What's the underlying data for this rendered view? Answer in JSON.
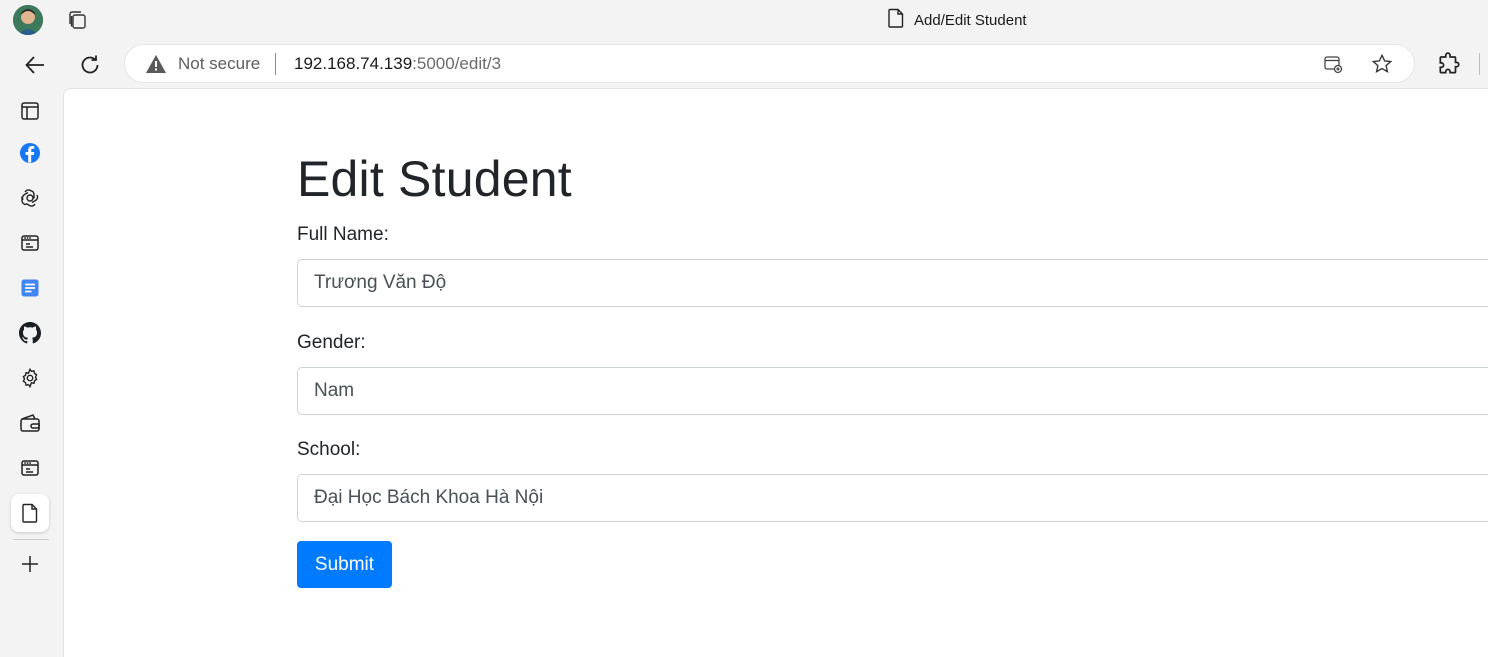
{
  "window": {
    "tab_title": "Add/Edit Student"
  },
  "toolbar": {
    "security_label": "Not secure",
    "url_host": "192.168.74.139",
    "url_path": ":5000/edit/3"
  },
  "sidebar": {
    "items": [
      {
        "name": "sidebar-icon"
      },
      {
        "name": "facebook-icon"
      },
      {
        "name": "openai-icon"
      },
      {
        "name": "app-window-icon"
      },
      {
        "name": "google-docs-icon"
      },
      {
        "name": "github-icon"
      },
      {
        "name": "settings-icon"
      },
      {
        "name": "wallet-icon"
      },
      {
        "name": "app-window-icon"
      },
      {
        "name": "page-icon"
      }
    ]
  },
  "form": {
    "heading": "Edit Student",
    "full_name_label": "Full Name:",
    "full_name_value": "Trương Văn Độ",
    "gender_label": "Gender:",
    "gender_value": "Nam",
    "school_label": "School:",
    "school_value": "Đại Học Bách Khoa Hà Nội",
    "submit_label": "Submit"
  },
  "colors": {
    "primary": "#007bff",
    "facebook": "#1877f2",
    "docs": "#4285f4"
  }
}
